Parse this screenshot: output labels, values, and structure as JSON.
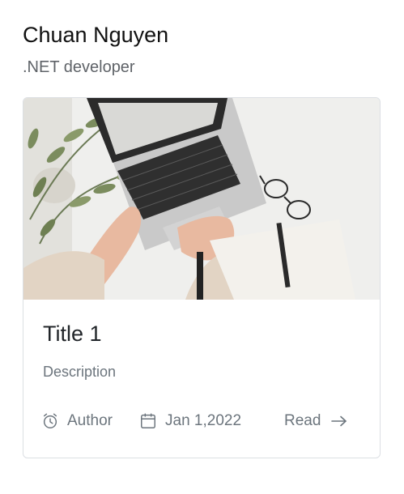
{
  "profile": {
    "name": "Chuan Nguyen",
    "role": ".NET developer"
  },
  "card": {
    "image_alt": "Hands typing on a laptop on a white desk with glasses, a plant and a notebook",
    "title": "Title 1",
    "description": "Description",
    "author_icon": "alarm-clock-icon",
    "author": "Author",
    "date_icon": "calendar-icon",
    "date": "Jan 1,2022",
    "read_label": "Read",
    "read_icon": "arrow-right-icon"
  },
  "colors": {
    "text_primary": "#212529",
    "text_muted": "#6c757d",
    "card_border": "#dcdfe3"
  }
}
